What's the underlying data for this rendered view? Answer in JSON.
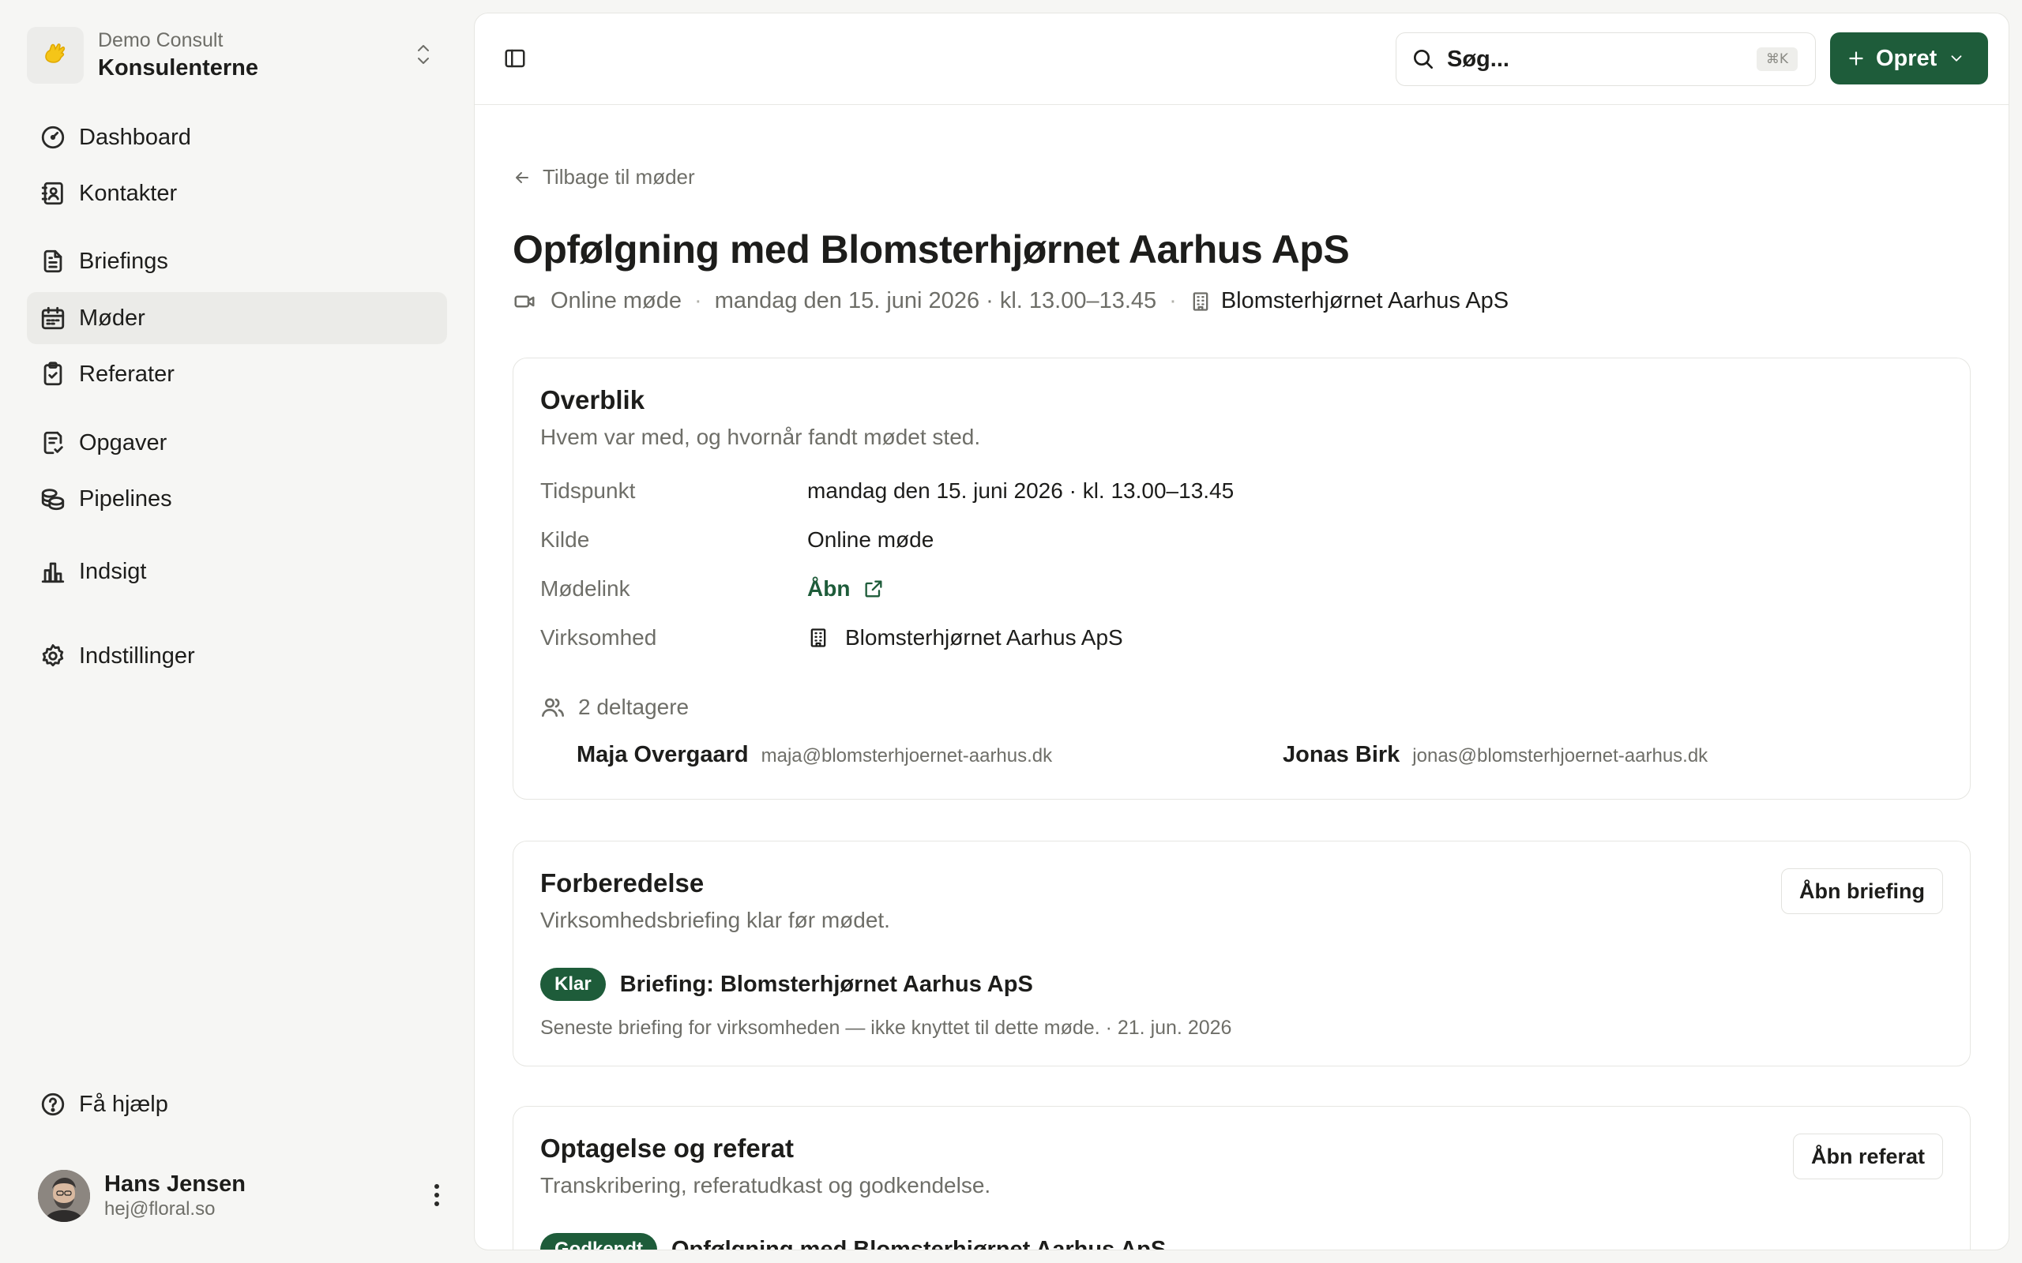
{
  "workspace": {
    "org": "Demo Consult",
    "name": "Konsulenterne"
  },
  "sidebar": {
    "items": [
      {
        "label": "Dashboard",
        "icon": "gauge-icon"
      },
      {
        "label": "Kontakter",
        "icon": "contacts-icon"
      },
      {
        "label": "Briefings",
        "icon": "file-text-icon"
      },
      {
        "label": "Møder",
        "icon": "calendar-icon",
        "active": true
      },
      {
        "label": "Referater",
        "icon": "clipboard-check-icon"
      },
      {
        "label": "Opgaver",
        "icon": "task-icon"
      },
      {
        "label": "Pipelines",
        "icon": "coins-icon"
      },
      {
        "label": "Indsigt",
        "icon": "bar-chart-icon"
      },
      {
        "label": "Indstillinger",
        "icon": "gear-icon"
      }
    ],
    "help": "Få hjælp"
  },
  "user": {
    "name": "Hans Jensen",
    "email": "hej@floral.so"
  },
  "topbar": {
    "search_placeholder": "Søg...",
    "search_shortcut": "⌘K",
    "create_label": "Opret"
  },
  "page": {
    "back_label": "Tilbage til møder",
    "title": "Opfølgning med Blomsterhjørnet Aarhus ApS",
    "meta": {
      "source": "Online møde",
      "datetime": "mandag den 15. juni 2026 · kl. 13.00–13.45",
      "company": "Blomsterhjørnet Aarhus ApS",
      "separator": "·"
    }
  },
  "overview": {
    "title": "Overblik",
    "subtitle": "Hvem var med, og hvornår fandt mødet sted.",
    "rows": [
      {
        "key": "Tidspunkt",
        "value": "mandag den 15. juni 2026 · kl. 13.00–13.45"
      },
      {
        "key": "Kilde",
        "value": "Online møde"
      },
      {
        "key": "Mødelink",
        "value": "Åbn"
      },
      {
        "key": "Virksomhed",
        "value": "Blomsterhjørnet Aarhus ApS"
      }
    ],
    "participants_label": "2 deltagere",
    "participants": [
      {
        "name": "Maja Overgaard",
        "email": "maja@blomsterhjoernet-aarhus.dk"
      },
      {
        "name": "Jonas Birk",
        "email": "jonas@blomsterhjoernet-aarhus.dk"
      }
    ]
  },
  "preparation": {
    "title": "Forberedelse",
    "subtitle": "Virksomhedsbriefing klar før mødet.",
    "button": "Åbn briefing",
    "badge": "Klar",
    "item_title": "Briefing: Blomsterhjørnet Aarhus ApS",
    "note": "Seneste briefing for virksomheden — ikke knyttet til dette møde. · 21. jun. 2026"
  },
  "recording": {
    "title": "Optagelse og referat",
    "subtitle": "Transkribering, referatudkast og godkendelse.",
    "button": "Åbn referat",
    "badge": "Godkendt",
    "item_title": "Opfølgning med Blomsterhjørnet Aarhus ApS"
  },
  "colors": {
    "accent": "#1e5c3a",
    "muted": "#6e6e68",
    "active_nav": "#ebebe8"
  }
}
